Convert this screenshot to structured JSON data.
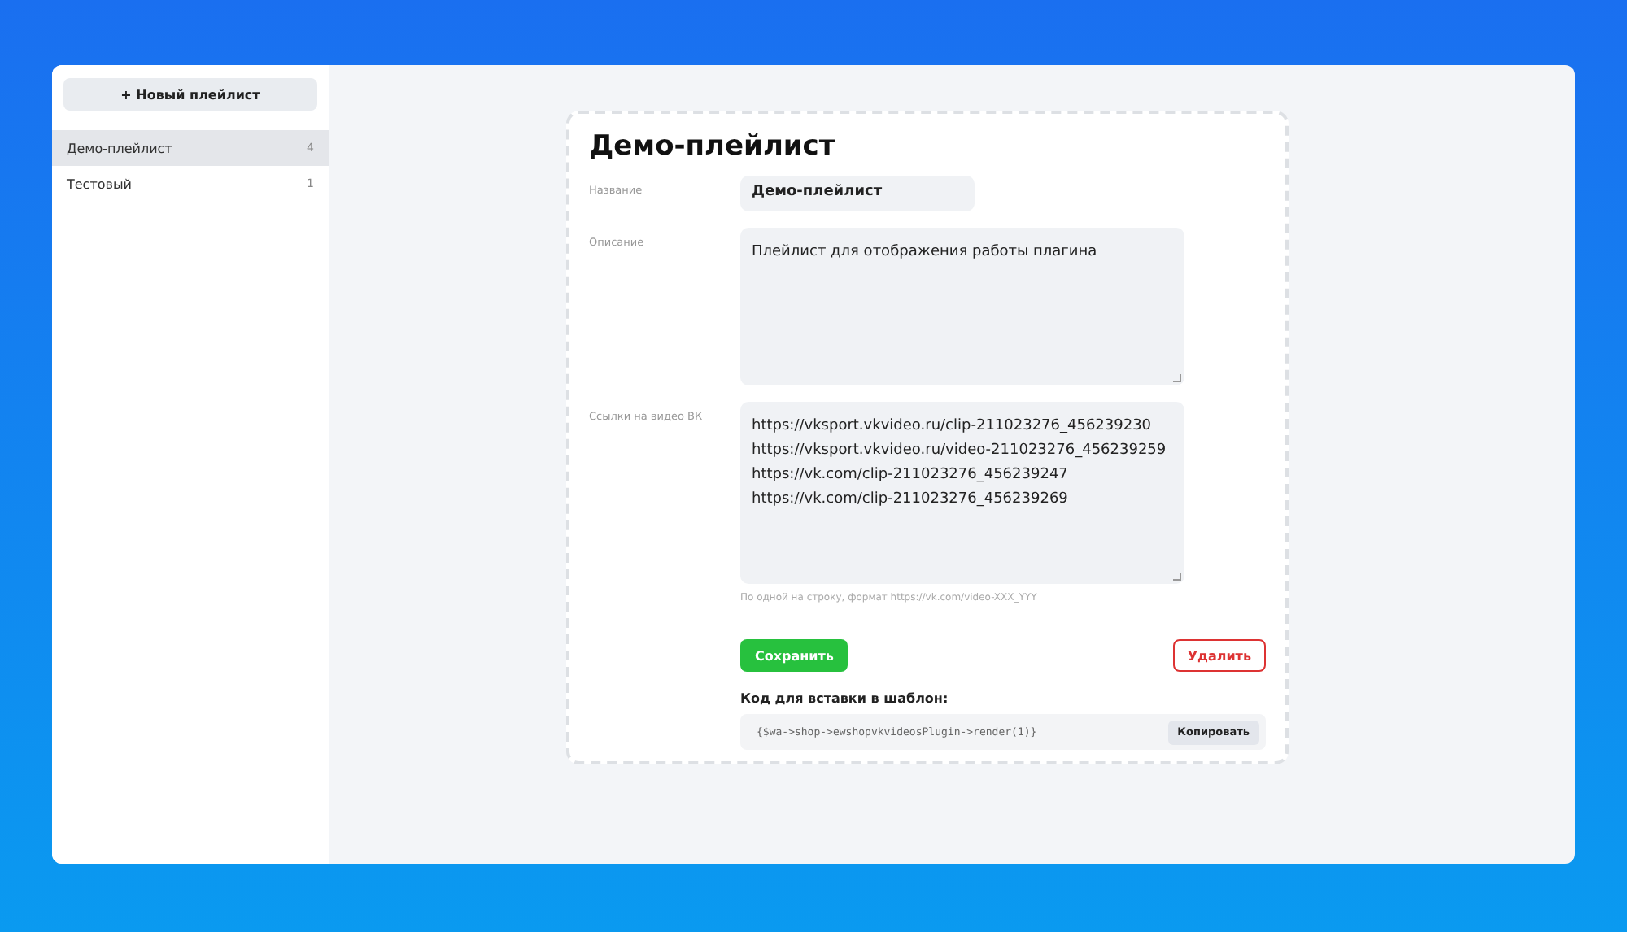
{
  "sidebar": {
    "new_button": "+ Новый плейлист",
    "items": [
      {
        "name": "Демо-плейлист",
        "count": "4",
        "selected": true
      },
      {
        "name": "Тестовый",
        "count": "1",
        "selected": false
      }
    ]
  },
  "editor": {
    "title": "Демо-плейлист",
    "name_label": "Название",
    "name_value": "Демо-плейлист",
    "description_label": "Описание",
    "description_value": "Плейлист для отображения работы плагина",
    "links_label": "Ссылки на видео ВК",
    "links": [
      "https://vksport.vkvideo.ru/clip-211023276_456239230",
      "https://vksport.vkvideo.ru/video-211023276_456239259",
      "https://vk.com/clip-211023276_456239247",
      "https://vk.com/clip-211023276_456239269"
    ],
    "links_hint": "По одной на строку, формат https://vk.com/video-XXX_YYY",
    "save_button": "Сохранить",
    "delete_button": "Удалить",
    "code_label": "Код для вставки в шаблон:",
    "code": "{$wa->shop->ewshopvkvideosPlugin->render(1)}",
    "copy_button": "Копировать"
  }
}
